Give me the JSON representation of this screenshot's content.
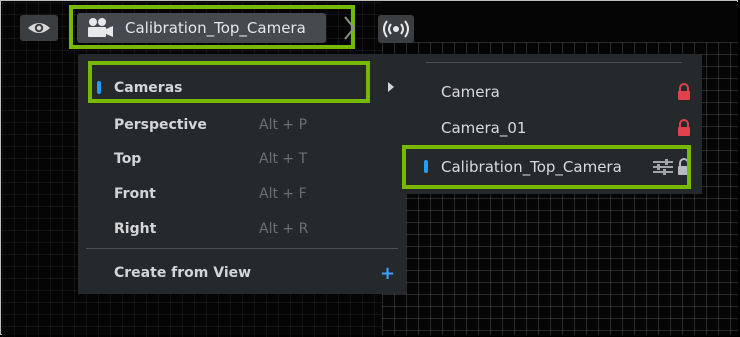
{
  "toolbar": {
    "eye_icon": "eye-icon",
    "camera_icon": "video-camera-icon",
    "active_camera": "Calibration_Top_Camera",
    "broadcast_icon": "broadcast-icon"
  },
  "menu": {
    "items": [
      {
        "label": "Cameras",
        "shortcut": "",
        "active": true,
        "has_submenu": true
      },
      {
        "label": "Perspective",
        "shortcut": "Alt + P"
      },
      {
        "label": "Top",
        "shortcut": "Alt + T"
      },
      {
        "label": "Front",
        "shortcut": "Alt + F"
      },
      {
        "label": "Right",
        "shortcut": "Alt + R"
      }
    ],
    "create_from_view": "Create from View"
  },
  "submenu": {
    "items": [
      {
        "label": "Camera",
        "locked": true
      },
      {
        "label": "Camera_01",
        "locked": true
      },
      {
        "label": "Calibration_Top_Camera",
        "active": true,
        "locked": true
      }
    ]
  },
  "colors": {
    "highlight": "#76b900",
    "marker": "#1f9fff",
    "lock": "#e0414b",
    "menu_bg": "#26292c"
  }
}
